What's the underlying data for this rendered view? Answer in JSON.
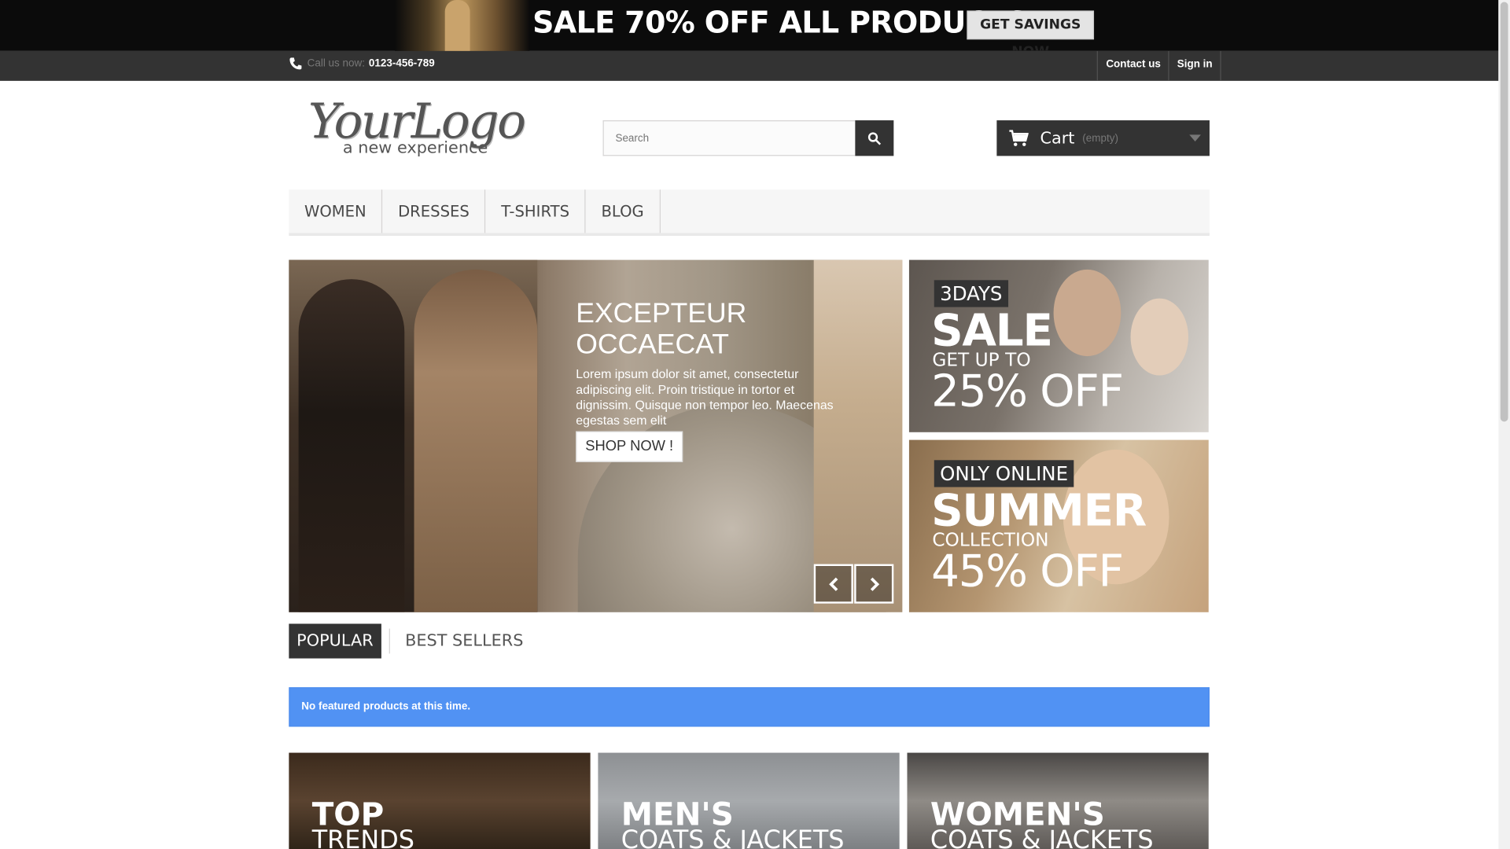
{
  "promo": {
    "title": "SALE 70% OFF ALL PRODUCTS",
    "button": "GET SAVINGS NOW"
  },
  "topbar": {
    "call_label": "Call us now:",
    "phone": "0123-456-789",
    "links": [
      "Contact us",
      "Sign in"
    ]
  },
  "header": {
    "logo_text": "YourLogo",
    "logo_tagline": "a new experience",
    "search_placeholder": "Search",
    "cart_label": "Cart",
    "cart_status": "(empty)"
  },
  "menu": {
    "items": [
      "WOMEN",
      "DRESSES",
      "T-SHIRTS",
      "BLOG"
    ]
  },
  "slider": {
    "title": "EXCEPTEUR OCCAECAT",
    "text": "Lorem ipsum dolor sit amet, consectetur adipiscing elit. Proin tristique in tortor et dignissim. Quisque non tempor leo. Maecenas egestas sem elit",
    "button": "SHOP NOW !"
  },
  "tiles": [
    {
      "tag": "3DAYS",
      "big": "SALE",
      "mid": "GET UP TO",
      "pct": "25% OFF"
    },
    {
      "tag": "ONLY ONLINE",
      "big": "SUMMER",
      "mid": "COLLECTION",
      "pct": "45% OFF"
    }
  ],
  "tabs": [
    "POPULAR",
    "BEST SELLERS"
  ],
  "alert": "No featured products at this time.",
  "banners": [
    {
      "title": "TOP",
      "sub": "TRENDS"
    },
    {
      "title": "MEN'S",
      "sub": "COATS & JACKETS"
    },
    {
      "title": "WOMEN'S",
      "sub": "COATS & JACKETS"
    }
  ],
  "colors": {
    "accent_blue": "#5192f3",
    "dark": "#333333"
  }
}
